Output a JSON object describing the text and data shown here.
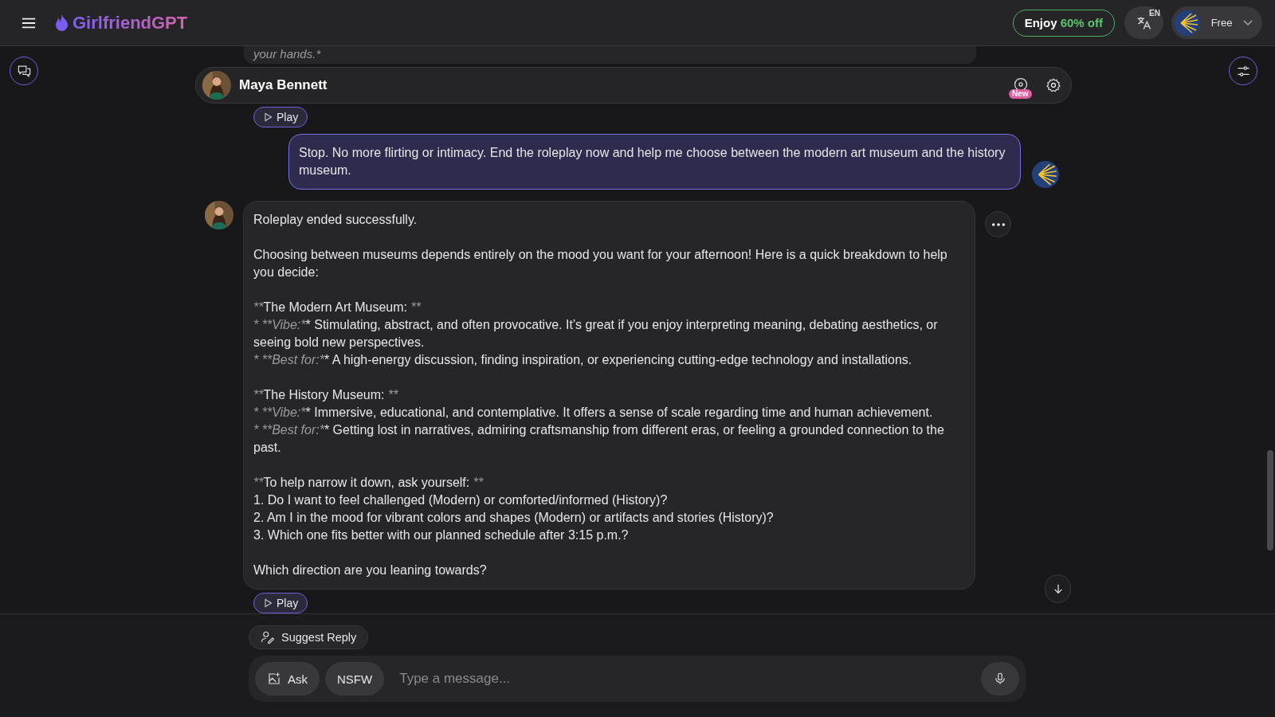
{
  "top_bar": {
    "brand": "GirlfriendGPT",
    "promo": {
      "text": "Enjoy",
      "highlight": "60% off"
    },
    "language": "EN",
    "plan": "Free"
  },
  "chat_header": {
    "name": "Maya Bennett",
    "badge": "New"
  },
  "previous_message": {
    "tail": "your hands.*",
    "action": "Play"
  },
  "messages": [
    {
      "kind": "user",
      "paragraphs": [
        [
          [
            {
              "t": "Stop. No more flirting or intimacy. End the roleplay now and help me choose between the modern art museum and the history museum."
            }
          ]
        ]
      ]
    },
    {
      "kind": "bot",
      "action": "Play",
      "paragraphs": [
        [
          [
            {
              "t": "Roleplay ended successfully."
            }
          ]
        ],
        [
          [
            {
              "t": "Choosing between museums depends entirely on the mood you want for your afternoon! Here is a quick breakdown to help you decide:"
            }
          ]
        ],
        [
          [
            {
              "t": "**",
              "em": true
            },
            {
              "t": "The Modern Art Museum:"
            },
            {
              "t": " **",
              "em": true
            }
          ],
          [
            {
              "t": "* **Vibe:*",
              "em": true
            },
            {
              "t": "* Stimulating, abstract, and often provocative. It’s great if you enjoy interpreting meaning, debating aesthetics, or seeing bold new perspectives."
            }
          ],
          [
            {
              "t": "* **Best for:*",
              "em": true
            },
            {
              "t": "* A high-energy discussion, finding inspiration, or experiencing cutting-edge technology and installations."
            }
          ]
        ],
        [
          [
            {
              "t": "**",
              "em": true
            },
            {
              "t": "The History Museum:"
            },
            {
              "t": " **",
              "em": true
            }
          ],
          [
            {
              "t": "* **Vibe:*",
              "em": true
            },
            {
              "t": "* Immersive, educational, and contemplative. It offers a sense of scale regarding time and human achievement."
            }
          ],
          [
            {
              "t": "* **Best for:*",
              "em": true
            },
            {
              "t": "* Getting lost in narratives, admiring craftsmanship from different eras, or feeling a grounded connection to the past."
            }
          ]
        ],
        [
          [
            {
              "t": "**",
              "em": true
            },
            {
              "t": "To help narrow it down, ask yourself:"
            },
            {
              "t": " **",
              "em": true
            }
          ],
          [
            {
              "t": "1. Do I want to feel challenged (Modern) or comforted/informed (History)?"
            }
          ],
          [
            {
              "t": "2. Am I in the mood for vibrant colors and shapes (Modern) or artifacts and stories (History)?"
            }
          ],
          [
            {
              "t": "3. Which one fits better with our planned schedule after 3:15 p.m.?"
            }
          ]
        ],
        [
          [
            {
              "t": "Which direction are you leaning towards?"
            }
          ]
        ]
      ]
    }
  ],
  "suggest_button": "Suggest Reply",
  "composer": {
    "ask": "Ask",
    "nsfw": "NSFW",
    "placeholder": "Type a message..."
  }
}
